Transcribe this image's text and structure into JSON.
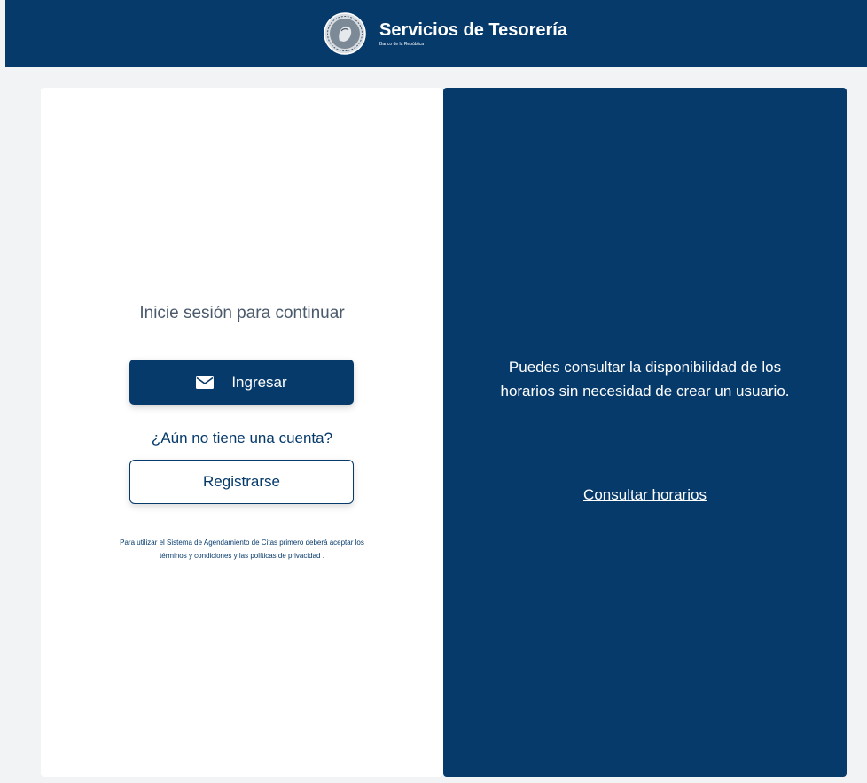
{
  "header": {
    "title": "Servicios de Tesorería",
    "subtitle": "Banco de la República",
    "logo_icon": "coin-seal-icon"
  },
  "login": {
    "prompt": "Inicie sesión para continuar",
    "login_button_label": "Ingresar",
    "login_button_icon": "mail-icon",
    "no_account_text": "¿Aún no tiene una cuenta?",
    "register_button_label": "Registrarse",
    "terms_line1": "Para utilizar el Sistema de Agendamiento de Citas primero deberá aceptar los",
    "terms_line2": "términos y condiciones y las políticas de privacidad ."
  },
  "info": {
    "line1": "Puedes consultar la disponibilidad de los",
    "line2": "horarios sin necesidad de crear un usuario.",
    "link_label": "Consultar horarios"
  },
  "colors": {
    "primary": "#063a6b",
    "background": "#f2f3f5",
    "card": "#ffffff"
  }
}
